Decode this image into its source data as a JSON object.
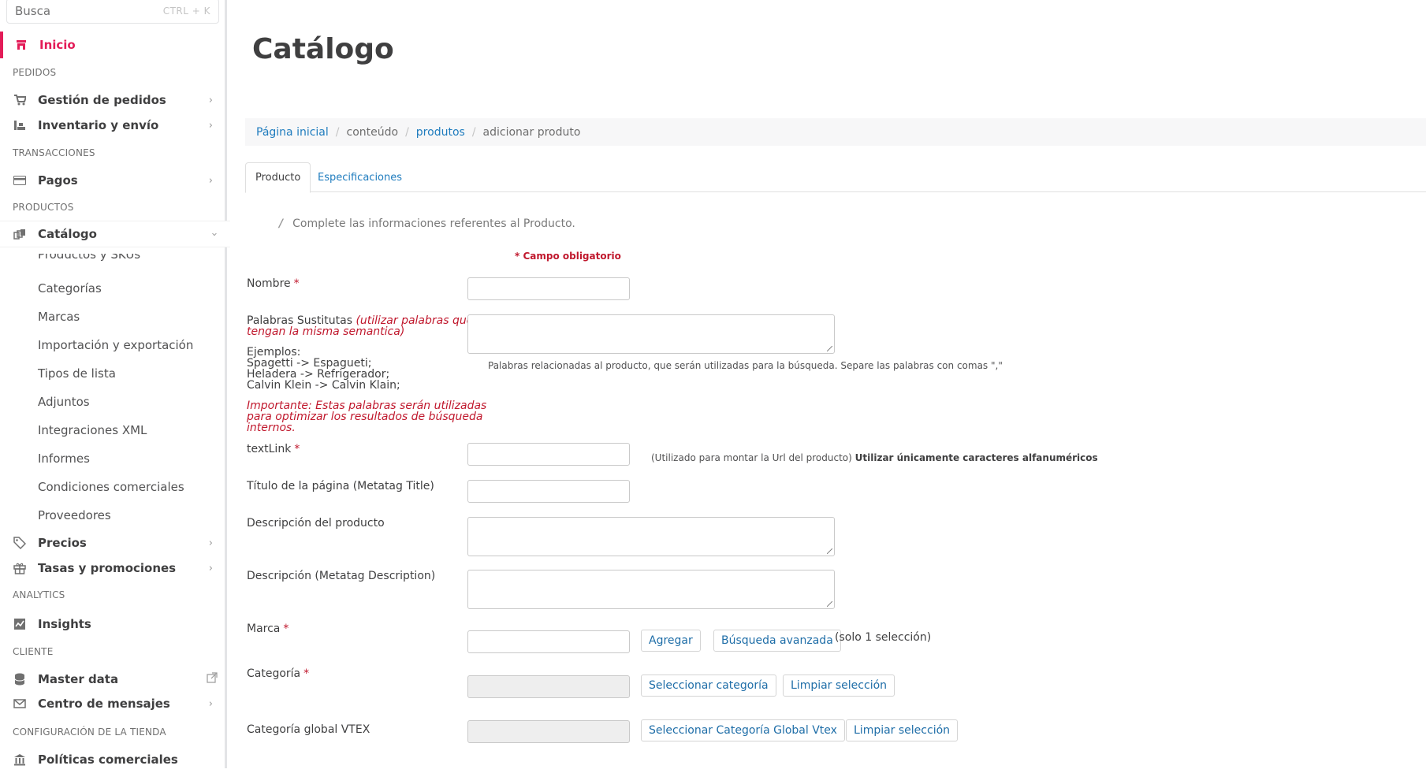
{
  "sidebar": {
    "search_placeholder": "Busca",
    "search_shortcut": "CTRL + K",
    "home": "Inicio",
    "sections": {
      "pedidos": "PEDIDOS",
      "transacciones": "TRANSACCIONES",
      "productos": "PRODUCTOS",
      "analytics": "ANALYTICS",
      "cliente": "CLIENTE",
      "config": "CONFIGURACIÓN DE LA TIENDA"
    },
    "items": {
      "gestion": "Gestión de pedidos",
      "inventario": "Inventario y envío",
      "pagos": "Pagos",
      "catalogo": "Catálogo",
      "precios": "Precios",
      "tasas": "Tasas y promociones",
      "insights": "Insights",
      "master": "Master data",
      "mensajes": "Centro de mensajes",
      "politicas": "Políticas comerciales"
    },
    "catalog_sub": [
      "Productos y SKUs",
      "Categorías",
      "Marcas",
      "Importación y exportación",
      "Tipos de lista",
      "Adjuntos",
      "Integraciones XML",
      "Informes",
      "Condiciones comerciales",
      "Proveedores"
    ]
  },
  "main": {
    "title": "Catálogo",
    "breadcrumb": {
      "home": "Página inicial",
      "content": "conteúdo",
      "products": "produtos",
      "current": "adicionar produto"
    },
    "tabs": {
      "producto": "Producto",
      "especificaciones": "Especificaciones"
    },
    "hint": "Complete las informaciones referentes al Producto.",
    "required_note": "* Campo obligatorio",
    "fields": {
      "nombre": "Nombre",
      "palabras": "Palabras Sustitutas",
      "palabras_note_1": "(utilizar palabras que",
      "palabras_note_2": "tengan la misma semantica)",
      "ejemplos_title": "Ejemplos:",
      "ejemplo_1": "Spagetti -> Espagueti;",
      "ejemplo_2": "Heladera -> Refrigerador;",
      "ejemplo_3": "Calvin Klein -> Calvin Klain;",
      "importante_1": "Importante: Estas palabras serán utilizadas",
      "importante_2": "para optimizar los resultados de búsqueda",
      "importante_3": "internos.",
      "palabras_help": "Palabras relacionadas al producto, que serán utilizadas para la búsqueda. Separe las palabras con comas \",\"",
      "textlink": "textLink",
      "textlink_help": "(Utilizado para montar la Url del producto)",
      "textlink_help_bold": "Utilizar únicamente caracteres alfanuméricos",
      "titulo": "Título de la página (Metatag Title)",
      "descripcion": "Descripción del producto",
      "descripcion_meta": "Descripción (Metatag Description)",
      "marca": "Marca",
      "agregar": "Agregar",
      "busqueda": "Búsqueda avanzada",
      "solo": "(solo 1 selección)",
      "categoria": "Categoría",
      "sel_categoria": "Seleccionar categoría",
      "limpiar": "Limpiar selección",
      "categoria_global": "Categoría global VTEX",
      "sel_global": "Seleccionar Categoría Global Vtex",
      "limpiar_global": "Limpiar selección"
    }
  },
  "colors": {
    "accent": "#e31c58",
    "link": "#1f7cbe",
    "required": "#c0182d"
  }
}
